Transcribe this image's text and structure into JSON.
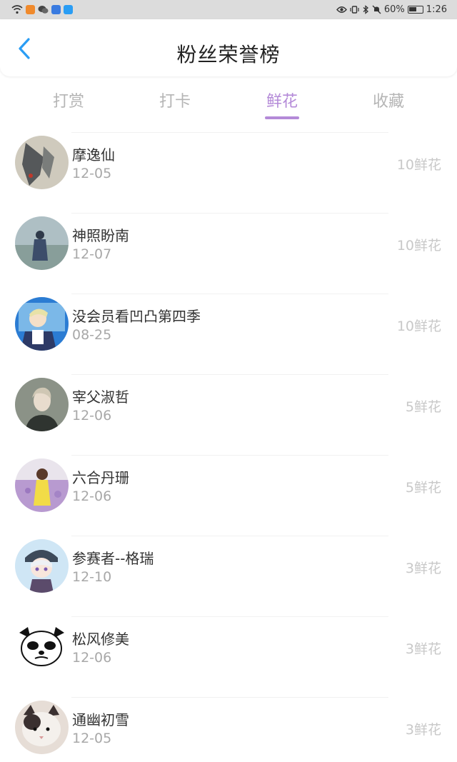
{
  "status_bar": {
    "battery": "60%",
    "time": "1:26"
  },
  "header": {
    "title": "粉丝荣誉榜"
  },
  "tabs": [
    {
      "label": "打赏",
      "active": false
    },
    {
      "label": "打卡",
      "active": false
    },
    {
      "label": "鲜花",
      "active": true
    },
    {
      "label": "收藏",
      "active": false
    }
  ],
  "colors": {
    "accent": "#b48ad8",
    "tab_inactive": "#b5b5b5",
    "count_text": "#c8c8c8",
    "status_bar_bg": "#dcdcdc"
  },
  "fans": [
    {
      "name": "摩逸仙",
      "date": "12-05",
      "count": "10鲜花"
    },
    {
      "name": "神照盼南",
      "date": "12-07",
      "count": "10鲜花"
    },
    {
      "name": "没会员看凹凸第四季",
      "date": "08-25",
      "count": "10鲜花"
    },
    {
      "name": "宰父淑哲",
      "date": "12-06",
      "count": "5鲜花"
    },
    {
      "name": "六合丹珊",
      "date": "12-06",
      "count": "5鲜花"
    },
    {
      "name": "参赛者--格瑞",
      "date": "12-10",
      "count": "3鲜花"
    },
    {
      "name": "松风修美",
      "date": "12-06",
      "count": "3鲜花"
    },
    {
      "name": "通幽初雪",
      "date": "12-05",
      "count": "3鲜花"
    }
  ]
}
